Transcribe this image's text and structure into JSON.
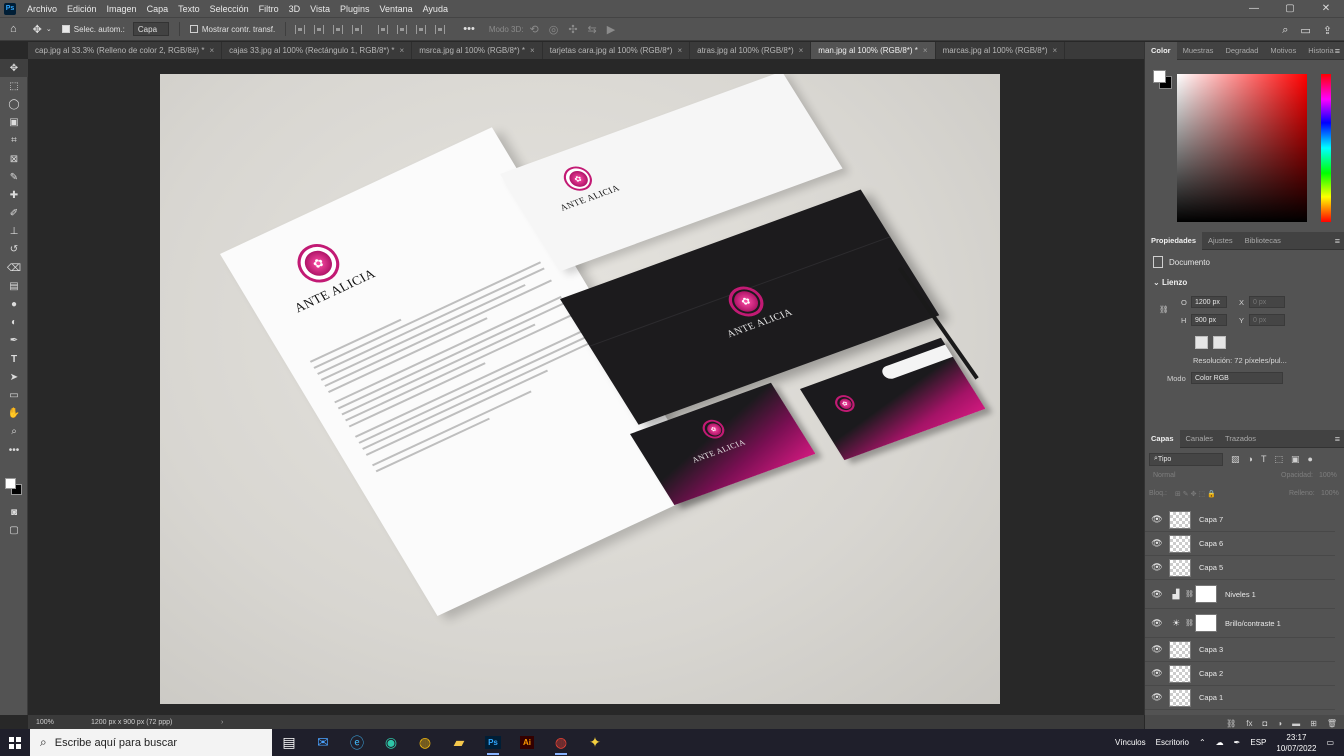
{
  "app": {
    "logo": "Ps"
  },
  "menu": [
    "Archivo",
    "Edición",
    "Imagen",
    "Capa",
    "Texto",
    "Selección",
    "Filtro",
    "3D",
    "Vista",
    "Plugins",
    "Ventana",
    "Ayuda"
  ],
  "window_controls": {
    "minimize": "—",
    "maximize": "▢",
    "close": "✕"
  },
  "options": {
    "auto_select_label": "Selec. autom.:",
    "auto_select_value": "Capa",
    "transform_label": "Mostrar contr. transf.",
    "mode_3d": "Modo 3D:"
  },
  "tabs": [
    "cap.jpg al 33.3% (Relleno de color 2, RGB/8#) *",
    "cajas 33.jpg al 100% (Rectángulo 1, RGB/8*) *",
    "msrca.jpg al 100% (RGB/8*) *",
    "tarjetas cara.jpg al 100% (RGB/8*)",
    "atras.jpg al 100% (RGB/8*)",
    "man.jpg al 100% (RGB/8*) *",
    "marcas.jpg al 100% (RGB/8*)"
  ],
  "active_tab_index": 5,
  "canvas": {
    "brand": "ANTE ALICIA"
  },
  "status": {
    "zoom": "100%",
    "doc_info": "1200 px x 900 px (72 ppp)",
    "arrow": "›"
  },
  "color_panel": {
    "tabs": [
      "Color",
      "Muestras",
      "Degradad",
      "Motivos",
      "Historia"
    ],
    "foreground": "#ffffff",
    "background": "#000000",
    "hue": "#ff0000"
  },
  "properties_panel": {
    "tabs": [
      "Propiedades",
      "Ajustes",
      "Bibliotecas"
    ],
    "doc_label": "Documento",
    "section": "Lienzo",
    "w_label": "O",
    "w_value": "1200 px",
    "x_label": "X",
    "x_placeholder": "0 px",
    "h_label": "H",
    "h_value": "900 px",
    "y_label": "Y",
    "y_placeholder": "0 px",
    "resolution": "Resolución: 72 píxeles/pul...",
    "mode_label": "Modo",
    "mode_value": "Color RGB"
  },
  "layers_panel": {
    "tabs": [
      "Capas",
      "Canales",
      "Trazados"
    ],
    "filter": "Tipo",
    "blend": "Normal",
    "opacity_label": "Opacidad:",
    "opacity_value": "100%",
    "lock_label": "Bloq.:",
    "fill_label": "Relleno:",
    "fill_value": "100%",
    "layers": [
      {
        "name": "Capa 7",
        "kind": "pixel"
      },
      {
        "name": "Capa 6",
        "kind": "pixel"
      },
      {
        "name": "Capa 5",
        "kind": "pixel"
      },
      {
        "name": "Niveles 1",
        "kind": "levels"
      },
      {
        "name": "Brillo/contraste 1",
        "kind": "brightness"
      },
      {
        "name": "Capa 3",
        "kind": "pixel"
      },
      {
        "name": "Capa 2",
        "kind": "pixel"
      },
      {
        "name": "Capa 1",
        "kind": "pixel"
      }
    ]
  },
  "taskbar": {
    "search_placeholder": "Escribe aquí para buscar",
    "tray_links": "Vínculos",
    "tray_desktop": "Escritorio",
    "language": "ESP",
    "time": "23:17",
    "date": "10/07/2022"
  }
}
